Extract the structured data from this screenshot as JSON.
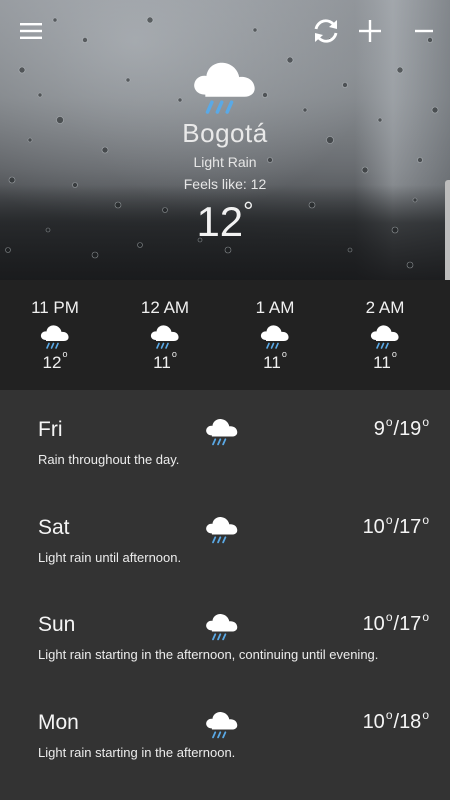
{
  "header": {
    "menu_icon": "hamburger-menu-icon",
    "refresh_icon": "refresh-icon",
    "add_icon": "plus-icon",
    "remove_icon": "minus-icon"
  },
  "current": {
    "city": "Bogotá",
    "condition": "Light Rain",
    "feels_like_label": "Feels like: ",
    "feels_like_value": "12",
    "temperature": "12",
    "degree_symbol": "°",
    "icon": "rain-cloud-icon"
  },
  "hourly": [
    {
      "time": "11 PM",
      "temp": "12",
      "icon": "rain-cloud-icon"
    },
    {
      "time": "12 AM",
      "temp": "11",
      "icon": "rain-cloud-icon"
    },
    {
      "time": "1 AM",
      "temp": "11",
      "icon": "rain-cloud-icon"
    },
    {
      "time": "2 AM",
      "temp": "11",
      "icon": "rain-cloud-icon"
    }
  ],
  "daily": [
    {
      "day": "Fri",
      "low": "9",
      "high": "19",
      "summary": "Rain throughout the day.",
      "icon": "rain-cloud-icon"
    },
    {
      "day": "Sat",
      "low": "10",
      "high": "17",
      "summary": "Light rain until afternoon.",
      "icon": "rain-cloud-icon"
    },
    {
      "day": "Sun",
      "low": "10",
      "high": "17",
      "summary": "Light rain starting in the afternoon, continuing until evening.",
      "icon": "rain-cloud-icon"
    },
    {
      "day": "Mon",
      "low": "10",
      "high": "18",
      "summary": "Light rain starting in the afternoon.",
      "icon": "rain-cloud-icon"
    }
  ],
  "colors": {
    "hourly_bg": "#222222",
    "daily_bg": "#333333",
    "rain_drop": "#5aa9e6",
    "text": "#ffffff"
  }
}
